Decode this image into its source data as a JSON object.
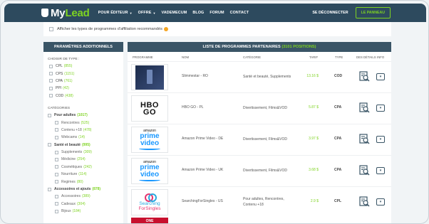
{
  "header": {
    "logo_prefix": "My",
    "logo_suffix": "Lead",
    "nav": [
      {
        "label": "POUR ÉDITEUR",
        "dropdown": true
      },
      {
        "label": "OFFRE",
        "dropdown": true
      },
      {
        "label": "VADEMECUM",
        "dropdown": false
      },
      {
        "label": "BLOG",
        "dropdown": false
      },
      {
        "label": "FORUM",
        "dropdown": false
      },
      {
        "label": "CONTACT",
        "dropdown": false
      }
    ],
    "logout": "SE DÉCONNECTER",
    "panel_button": "LE PANNEAU"
  },
  "filterbar": {
    "checkbox_label": "Afficher les types de programmes d'affiliation recommandés",
    "checked": false
  },
  "sidebar": {
    "title": "PARAMÈTRES ADDITIONNELS",
    "type_section": "CHOISIR DE TYPE :",
    "types": [
      {
        "label": "CPL",
        "count": "(855)"
      },
      {
        "label": "CPS",
        "count": "(1151)"
      },
      {
        "label": "CPA",
        "count": "(761)"
      },
      {
        "label": "PPI",
        "count": "(42)"
      },
      {
        "label": "COD",
        "count": "(438)"
      }
    ],
    "categories_section": "CATÉGORIES",
    "categories": [
      {
        "label": "Pour adultes",
        "count": "(1017)",
        "children": [
          {
            "label": "Rencontres",
            "count": "(525)"
          },
          {
            "label": "Contenu +18",
            "count": "(478)"
          },
          {
            "label": "Webcams",
            "count": "(14)"
          }
        ]
      },
      {
        "label": "Santé et beauté",
        "count": "(995)",
        "children": [
          {
            "label": "Supplements",
            "count": "(309)"
          },
          {
            "label": "Médicine",
            "count": "(254)"
          },
          {
            "label": "Cosmétiques",
            "count": "(242)"
          },
          {
            "label": "Nourriture",
            "count": "(114)"
          },
          {
            "label": "Regimes",
            "count": "(80)"
          }
        ]
      },
      {
        "label": "Accessoires et ajouts",
        "count": "(878)",
        "children": [
          {
            "label": "Accessoires",
            "count": "(389)"
          },
          {
            "label": "Cadeaux",
            "count": "(304)"
          },
          {
            "label": "Bijoux",
            "count": "(184)"
          }
        ]
      }
    ]
  },
  "main": {
    "title": "LISTE DE PROGRAMMES PARTENAIRES",
    "positions": "(3101 POSITIONS)",
    "columns": {
      "program": "PROGRAMME",
      "name": "NOM",
      "category": "CATÉGORIE",
      "rate": "TARIF",
      "type": "TYPE",
      "details": "DES DÉTAILS",
      "info": "INFO"
    },
    "rows": [
      {
        "logo": "slimmestar",
        "name": "Slimmestar - RO",
        "category": "Santé et beauté, Supplements",
        "category2": "",
        "price": "13.16 $",
        "type": "COD"
      },
      {
        "logo": "hbo",
        "logo_text1": "HBO",
        "logo_text2": "GO",
        "name": "HBO GO - PL",
        "category": "Divertissement, Films&VOD",
        "category2": "",
        "price": "5.87 $",
        "type": "CPA"
      },
      {
        "logo": "prime",
        "logo_text1": "amazon",
        "logo_text2": "prime video",
        "name": "Amazon Prime Video - DE",
        "category": "Divertissement, Films&VOD",
        "category2": "",
        "price": "3.97 $",
        "type": "CPA"
      },
      {
        "logo": "prime",
        "logo_text1": "amazon",
        "logo_text2": "prime video",
        "name": "Amazon Prime Video - UK",
        "category": "Divertissement, Films&VOD",
        "category2": "",
        "price": "3.68 $",
        "type": "CPA"
      },
      {
        "logo": "sfs",
        "logo_text1": "Searching",
        "logo_text2": "ForSingles",
        "name": "SearchingForSingles - US",
        "category": "Pour adultes, Rencontres,",
        "category2": "Contenu +18",
        "price": "2.9 $",
        "type": "CPL"
      }
    ],
    "partial_logo_text": "ONE"
  },
  "colors": {
    "header": "#2d4a5e",
    "section_head": "#3a5566",
    "accent": "#7ed321"
  }
}
